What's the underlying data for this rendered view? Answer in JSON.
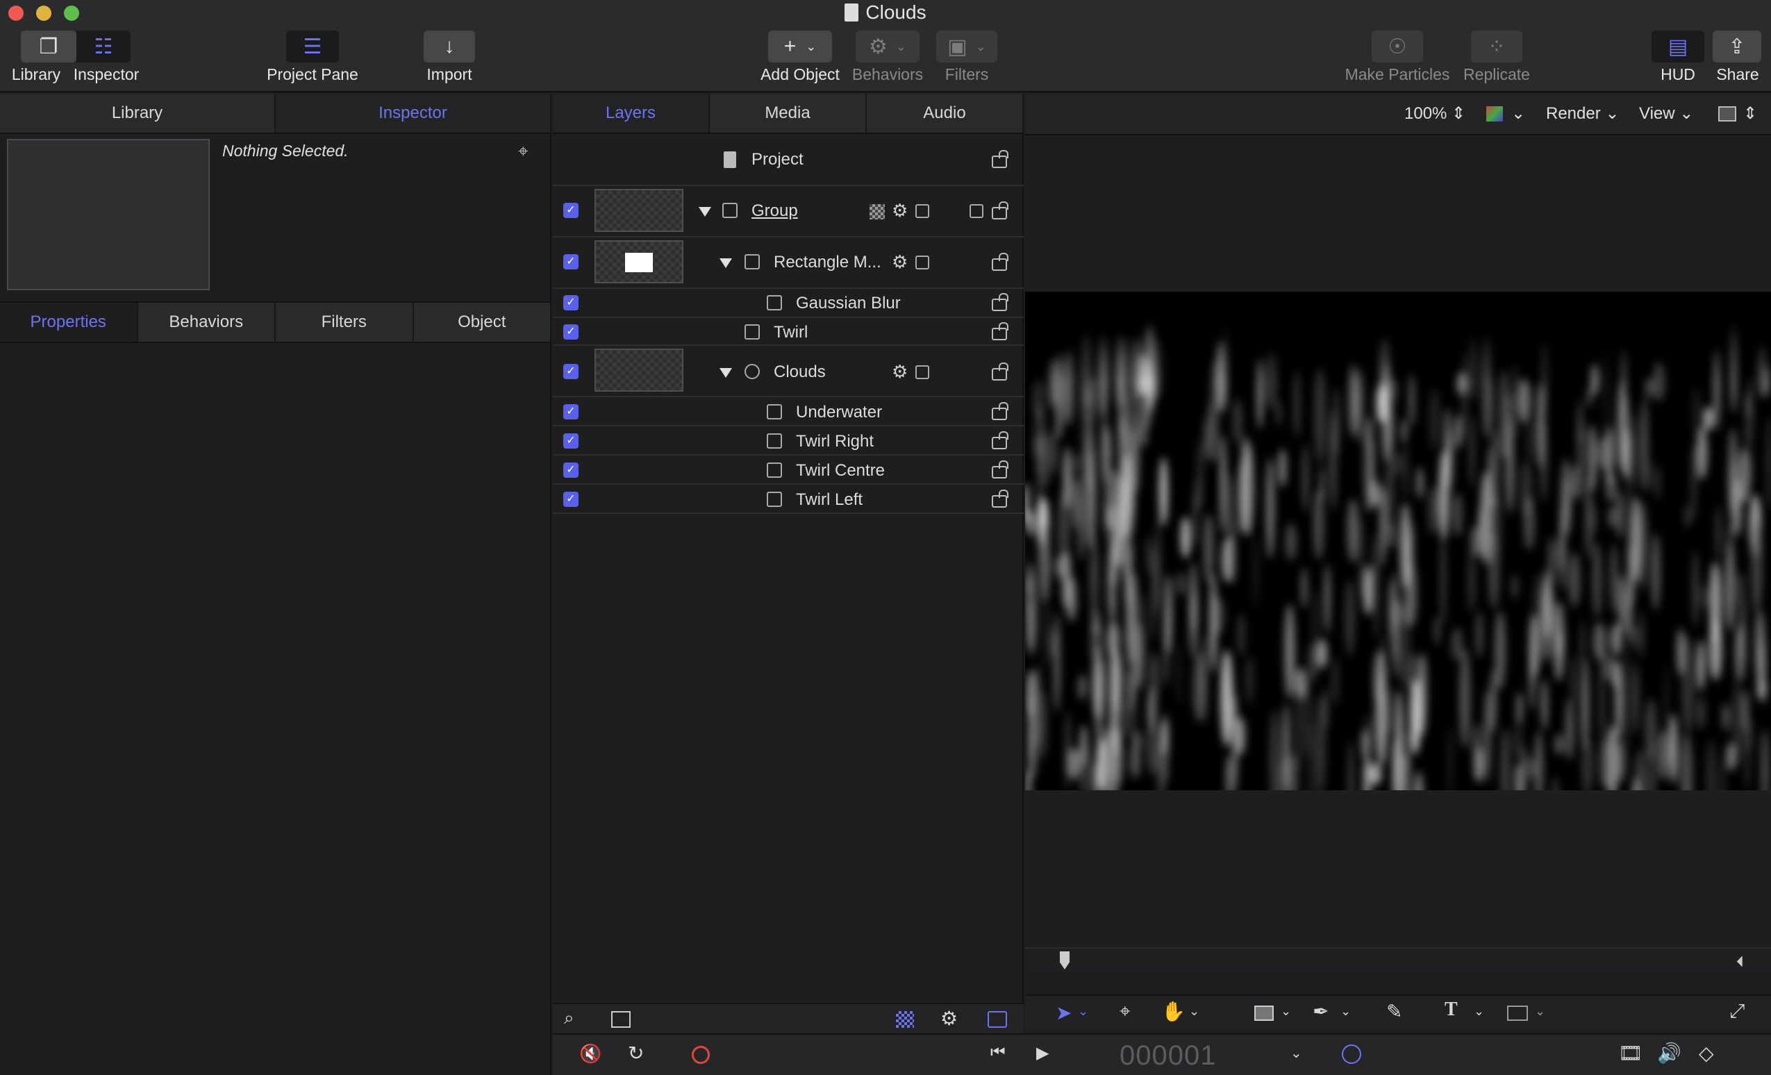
{
  "window": {
    "title": "Clouds"
  },
  "toolbar": {
    "library": "Library",
    "inspector": "Inspector",
    "project_pane": "Project Pane",
    "import": "Import",
    "add_object": "Add Object",
    "behaviors": "Behaviors",
    "filters": "Filters",
    "make_particles": "Make Particles",
    "replicate": "Replicate",
    "hud": "HUD",
    "share": "Share"
  },
  "left_tabs": {
    "library": "Library",
    "inspector": "Inspector"
  },
  "inspector": {
    "status": "Nothing Selected."
  },
  "inspector_tabs": {
    "properties": "Properties",
    "behaviors": "Behaviors",
    "filters": "Filters",
    "object": "Object"
  },
  "layer_tabs": {
    "layers": "Layers",
    "media": "Media",
    "audio": "Audio"
  },
  "layers": {
    "project": "Project",
    "group": "Group",
    "rectangle_mask": "Rectangle M...",
    "gaussian_blur": "Gaussian Blur",
    "twirl": "Twirl",
    "clouds": "Clouds",
    "underwater": "Underwater",
    "twirl_right": "Twirl Right",
    "twirl_centre": "Twirl Centre",
    "twirl_left": "Twirl Left"
  },
  "viewer": {
    "zoom": "100%",
    "render": "Render",
    "view": "View"
  },
  "transport": {
    "timecode": "000001"
  },
  "colors": {
    "accent": "#6d74f2",
    "checkbox": "#5b60e8",
    "close": "#ee5a52",
    "minimize": "#e0b341",
    "zoom": "#5fbf4c",
    "record": "#e0453a"
  },
  "icons": [
    "library-icon",
    "inspector-icon",
    "project-pane-icon",
    "import-icon",
    "add-icon",
    "behaviors-icon",
    "filters-icon",
    "particles-icon",
    "replicate-icon",
    "hud-icon",
    "share-icon",
    "pin-icon",
    "lock-icon",
    "gear-icon",
    "search-icon"
  ]
}
